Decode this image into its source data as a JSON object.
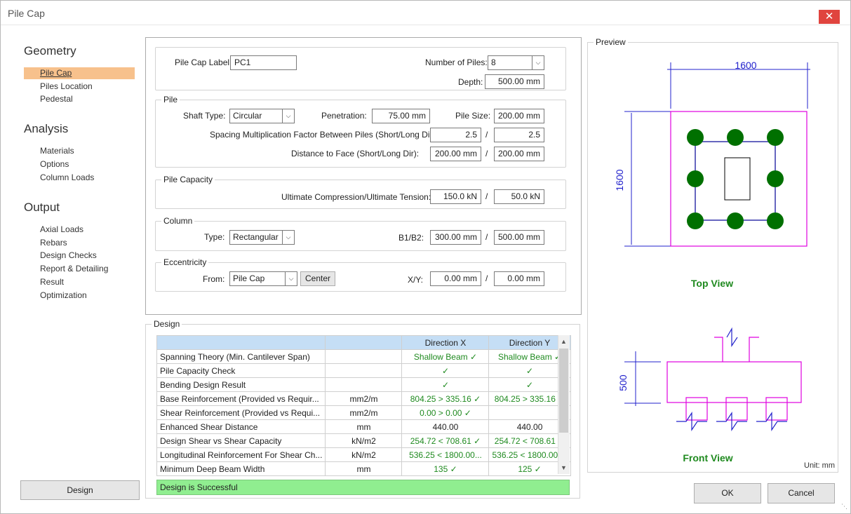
{
  "window": {
    "title": "Pile Cap",
    "close_glyph": "✕"
  },
  "nav": {
    "geometry": {
      "heading": "Geometry",
      "items": [
        "Pile Cap",
        "Piles Location",
        "Pedestal"
      ]
    },
    "analysis": {
      "heading": "Analysis",
      "items": [
        "Materials",
        "Options",
        "Column Loads"
      ]
    },
    "output": {
      "heading": "Output",
      "items": [
        "Axial Loads",
        "Rebars",
        "Design Checks",
        "Report & Detailing",
        "Result",
        "Optimization"
      ]
    },
    "active_item": "Pile Cap",
    "design_button": "Design"
  },
  "general": {
    "label_caption": "Pile Cap Label:",
    "label_value": "PC1",
    "piles_caption": "Number of Piles:",
    "piles_value": "8",
    "depth_caption": "Depth:",
    "depth_value": "500.00 mm"
  },
  "pile": {
    "title": "Pile",
    "shaft_caption": "Shaft Type:",
    "shaft_value": "Circular",
    "penetration_caption": "Penetration:",
    "penetration_value": "75.00 mm",
    "size_caption": "Pile Size:",
    "size_value": "200.00 mm",
    "spacing_caption": "Spacing Multiplication Factor Between Piles (Short/Long Dir):",
    "spacing_short": "2.5",
    "spacing_long": "2.5",
    "face_caption": "Distance to Face (Short/Long Dir):",
    "face_short": "200.00 mm",
    "face_long": "200.00 mm",
    "slash": "/"
  },
  "capacity": {
    "title": "Pile Capacity",
    "caption": "Ultimate Compression/Ultimate Tension:",
    "compression": "150.0 kN",
    "tension": "50.0 kN"
  },
  "column": {
    "title": "Column",
    "type_caption": "Type:",
    "type_value": "Rectangular",
    "b_caption": "B1/B2:",
    "b1": "300.00 mm",
    "b2": "500.00 mm"
  },
  "eccentricity": {
    "title": "Eccentricity",
    "from_caption": "From:",
    "from_value": "Pile Cap",
    "center_button": "Center",
    "xy_caption": "X/Y:",
    "x": "0.00 mm",
    "y": "0.00 mm"
  },
  "design": {
    "title": "Design",
    "headers": [
      "",
      "",
      "Direction X",
      "Direction Y"
    ],
    "rows": [
      [
        "Spanning Theory (Min. Cantilever Span)",
        "",
        "Shallow Beam ✓",
        "Shallow Beam ✓"
      ],
      [
        "Pile Capacity Check",
        "",
        "✓",
        "✓"
      ],
      [
        "Bending Design Result",
        "",
        "✓",
        "✓"
      ],
      [
        "Base Reinforcement (Provided vs Requir...",
        "mm2/m",
        "804.25 > 335.16 ✓",
        "804.25 > 335.16 ✓"
      ],
      [
        "Shear Reinforcement (Provided vs Requi...",
        "mm2/m",
        "0.00 > 0.00 ✓",
        ""
      ],
      [
        "Enhanced Shear Distance",
        "mm",
        "440.00",
        "440.00"
      ],
      [
        "Design Shear vs Shear Capacity",
        "kN/m2",
        "254.72 < 708.61 ✓",
        "254.72 < 708.61 ✓"
      ],
      [
        "Longitudinal Reinforcement For Shear Ch...",
        "kN/m2",
        "536.25 < 1800.00...",
        "536.25 < 1800.00 ✓"
      ],
      [
        "Minimum Deep Beam Width",
        "mm",
        "135 ✓",
        "125 ✓"
      ]
    ],
    "status": "Design is Successful",
    "status_color": "#90ee90",
    "check_color": "#1f8a1f"
  },
  "preview": {
    "title": "Preview",
    "top_width_dim": "1600",
    "top_height_dim": "1600",
    "top_view_label": "Top View",
    "front_depth_dim": "500",
    "front_view_label": "Front View",
    "unit": "Unit: mm",
    "pile_color": "#007000",
    "cap_color": "#e000e0",
    "dim_color": "#2222cc",
    "label_color": "#1f8a1f"
  },
  "buttons": {
    "ok": "OK",
    "cancel": "Cancel"
  }
}
